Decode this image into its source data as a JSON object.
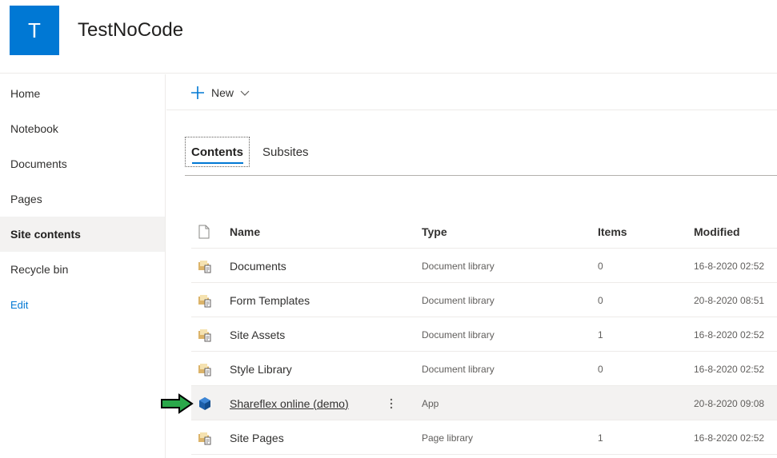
{
  "header": {
    "logo_letter": "T",
    "site_title": "TestNoCode"
  },
  "nav": {
    "items": [
      {
        "label": "Home"
      },
      {
        "label": "Notebook"
      },
      {
        "label": "Documents"
      },
      {
        "label": "Pages"
      },
      {
        "label": "Site contents",
        "selected": true
      },
      {
        "label": "Recycle bin"
      }
    ],
    "edit_label": "Edit"
  },
  "command_bar": {
    "new_label": "New"
  },
  "tabs": [
    {
      "label": "Contents",
      "selected": true
    },
    {
      "label": "Subsites"
    }
  ],
  "table": {
    "columns": {
      "name": "Name",
      "type": "Type",
      "items": "Items",
      "modified": "Modified"
    },
    "rows": [
      {
        "icon": "document-library-icon",
        "name": "Documents",
        "type": "Document library",
        "items": "0",
        "modified": "16-8-2020 02:52"
      },
      {
        "icon": "document-library-icon",
        "name": "Form Templates",
        "type": "Document library",
        "items": "0",
        "modified": "20-8-2020 08:51"
      },
      {
        "icon": "document-library-icon",
        "name": "Site Assets",
        "type": "Document library",
        "items": "1",
        "modified": "16-8-2020 02:52"
      },
      {
        "icon": "document-library-icon",
        "name": "Style Library",
        "type": "Document library",
        "items": "0",
        "modified": "16-8-2020 02:52"
      },
      {
        "icon": "app-icon",
        "name": "Shareflex online (demo)",
        "type": "App",
        "items": "",
        "modified": "20-8-2020 09:08"
      },
      {
        "icon": "document-library-icon",
        "name": "Site Pages",
        "type": "Page library",
        "items": "1",
        "modified": "16-8-2020 02:52"
      }
    ]
  },
  "colors": {
    "accent": "#0078d4",
    "arrow": "#2aa84a"
  }
}
